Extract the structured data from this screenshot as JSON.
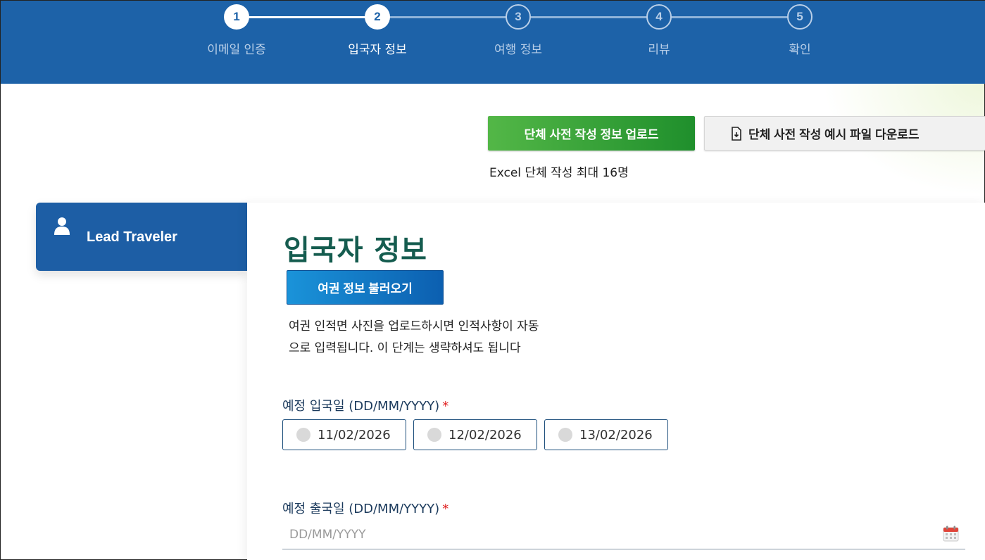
{
  "stepper": {
    "steps": [
      {
        "number": "1",
        "label": "이메일 인증"
      },
      {
        "number": "2",
        "label": "입국자 정보"
      },
      {
        "number": "3",
        "label": "여행 정보"
      },
      {
        "number": "4",
        "label": "리뷰"
      },
      {
        "number": "5",
        "label": "확인"
      }
    ],
    "current_step": 2
  },
  "group_upload": {
    "upload_label": "단체 사전 작성 정보 업로드",
    "download_label": "단체 사전 작성 예시 파일 다운로드",
    "note": "Excel 단체 작성 최대 16명"
  },
  "sidebar": {
    "traveler_label": "Lead Traveler"
  },
  "form": {
    "title": "입국자 정보",
    "passport_button": "여권 정보 불러오기",
    "passport_desc_line1": "여권 인적면 사진을 업로드하시면 인적사항이 자동",
    "passport_desc_line2": "으로 입력됩니다. 이 단계는 생략하셔도 됩니다",
    "entry_date_label": "예정 입국일 (DD/MM/YYYY)",
    "entry_date_options": [
      "11/02/2026",
      "12/02/2026",
      "13/02/2026"
    ],
    "exit_date_label": "예정 출국일 (DD/MM/YYYY)",
    "exit_date_placeholder": "DD/MM/YYYY",
    "required_mark": "*"
  },
  "colors": {
    "header_bg": "#1d62a8",
    "title_green": "#155c4f",
    "upload_green": "#2a9a35",
    "passport_blue": "#0c6fc0",
    "required_red": "#e02020"
  },
  "icons": [
    "person-icon",
    "file-download-icon",
    "calendar-icon"
  ]
}
